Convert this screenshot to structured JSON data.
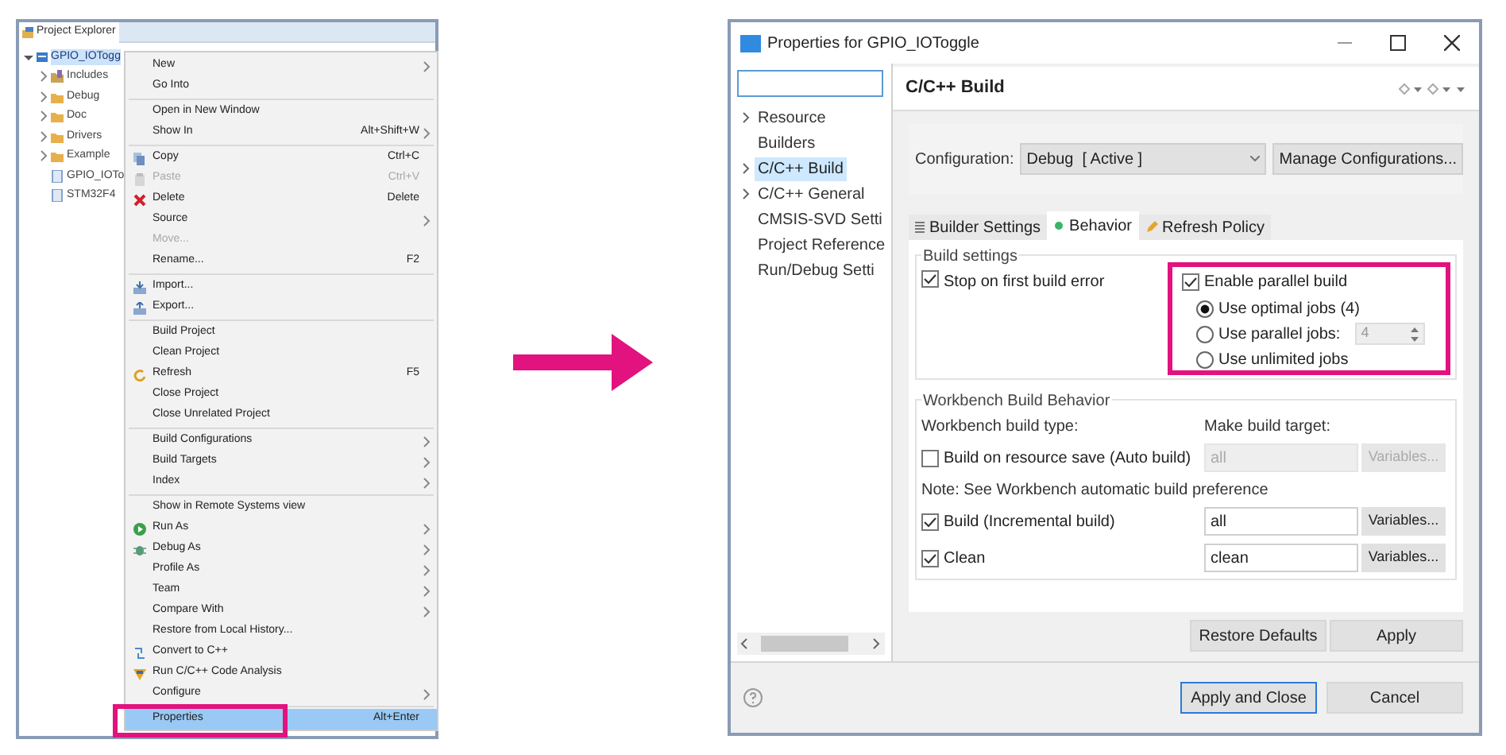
{
  "explorer": {
    "tab_title": "Project Explorer",
    "project": {
      "label": "GPIO_IOTogg",
      "expanded": true,
      "selected": true
    },
    "children": [
      {
        "label": "Includes",
        "kind": "includes",
        "expanded": false
      },
      {
        "label": "Debug",
        "kind": "folder",
        "expanded": false
      },
      {
        "label": "Doc",
        "kind": "folder",
        "expanded": false
      },
      {
        "label": "Drivers",
        "kind": "folder",
        "expanded": false
      },
      {
        "label": "Example",
        "kind": "folder",
        "expanded": false
      },
      {
        "label": "GPIO_IOTo",
        "kind": "file"
      },
      {
        "label": "STM32F4",
        "kind": "file"
      }
    ]
  },
  "context_menu": {
    "groups": [
      [
        {
          "label": "New",
          "submenu": true,
          "disabled": false,
          "selected": false
        },
        {
          "label": "Go Into",
          "disabled": false,
          "selected": false
        }
      ],
      [
        {
          "label": "Open in New Window",
          "disabled": false,
          "selected": false
        },
        {
          "label": "Show In",
          "shortcut": "Alt+Shift+W",
          "submenu": true,
          "disabled": false,
          "selected": false
        }
      ],
      [
        {
          "label": "Copy",
          "shortcut": "Ctrl+C",
          "kind": "copy",
          "disabled": false,
          "selected": false
        },
        {
          "label": "Paste",
          "shortcut": "Ctrl+V",
          "kind": "paste",
          "disabled": true,
          "selected": false
        },
        {
          "label": "Delete",
          "shortcut": "Delete",
          "kind": "delete",
          "disabled": false,
          "selected": false
        },
        {
          "label": "Source",
          "submenu": true,
          "disabled": false,
          "selected": false
        },
        {
          "label": "Move...",
          "disabled": true,
          "selected": false
        },
        {
          "label": "Rename...",
          "shortcut": "F2",
          "disabled": false,
          "selected": false
        }
      ],
      [
        {
          "label": "Import...",
          "kind": "import",
          "disabled": false,
          "selected": false
        },
        {
          "label": "Export...",
          "kind": "export",
          "disabled": false,
          "selected": false
        }
      ],
      [
        {
          "label": "Build Project",
          "disabled": false,
          "selected": false
        },
        {
          "label": "Clean Project",
          "disabled": false,
          "selected": false
        },
        {
          "label": "Refresh",
          "shortcut": "F5",
          "kind": "refresh",
          "disabled": false,
          "selected": false
        },
        {
          "label": "Close Project",
          "disabled": false,
          "selected": false
        },
        {
          "label": "Close Unrelated Project",
          "disabled": false,
          "selected": false
        }
      ],
      [
        {
          "label": "Build Configurations",
          "submenu": true,
          "disabled": false,
          "selected": false
        },
        {
          "label": "Build Targets",
          "submenu": true,
          "disabled": false,
          "selected": false
        },
        {
          "label": "Index",
          "submenu": true,
          "disabled": false,
          "selected": false
        }
      ],
      [
        {
          "label": "Show in Remote Systems view",
          "disabled": false,
          "selected": false
        },
        {
          "label": "Run As",
          "submenu": true,
          "kind": "run",
          "disabled": false,
          "selected": false
        },
        {
          "label": "Debug As",
          "submenu": true,
          "kind": "debug",
          "disabled": false,
          "selected": false
        },
        {
          "label": "Profile As",
          "submenu": true,
          "disabled": false,
          "selected": false
        },
        {
          "label": "Team",
          "submenu": true,
          "disabled": false,
          "selected": false
        },
        {
          "label": "Compare With",
          "submenu": true,
          "disabled": false,
          "selected": false
        },
        {
          "label": "Restore from Local History...",
          "disabled": false,
          "selected": false
        },
        {
          "label": "Convert to C++",
          "kind": "convert",
          "disabled": false,
          "selected": false
        },
        {
          "label": "Run C/C++ Code Analysis",
          "kind": "analysis",
          "disabled": false,
          "selected": false
        },
        {
          "label": "Configure",
          "submenu": true,
          "disabled": false,
          "selected": false
        }
      ],
      [
        {
          "label": "Properties",
          "shortcut": "Alt+Enter",
          "disabled": false,
          "selected": true,
          "annotated": true
        }
      ]
    ]
  },
  "dialog": {
    "title": "Properties for GPIO_IOToggle",
    "nav": [
      {
        "label": "Resource",
        "expanded": false,
        "selected": false
      },
      {
        "label": "Builders",
        "selected": false
      },
      {
        "label": "C/C++ Build",
        "expanded": false,
        "selected": true
      },
      {
        "label": "C/C++ General",
        "expanded": false,
        "selected": false
      },
      {
        "label": "CMSIS-SVD Setti",
        "selected": false
      },
      {
        "label": "Project Reference",
        "selected": false
      },
      {
        "label": "Run/Debug Setti",
        "selected": false
      }
    ],
    "page_title": "C/C++ Build",
    "configuration": {
      "label": "Configuration:",
      "value": "Debug  [ Active ]",
      "button": "Manage Configurations..."
    },
    "tabs": [
      {
        "label": "Builder Settings",
        "kind": "list",
        "selected": false
      },
      {
        "label": "Behavior",
        "kind": "dot",
        "selected": true
      },
      {
        "label": "Refresh Policy",
        "kind": "pencil",
        "selected": false
      }
    ],
    "build_settings": {
      "title": "Build settings",
      "stop_on_error": {
        "label": "Stop on first build error",
        "checked": true
      },
      "parallel": {
        "annotated": true,
        "label": "Enable parallel build",
        "checked": true,
        "options": [
          {
            "label": "Use optimal jobs (4)",
            "selected": true
          },
          {
            "label": "Use parallel jobs:",
            "selected": false,
            "spinner": "4"
          },
          {
            "label": "Use unlimited jobs",
            "selected": false
          }
        ]
      }
    },
    "workbench": {
      "title": "Workbench Build Behavior",
      "type_label": "Workbench build type:",
      "target_label": "Make build target:",
      "auto": {
        "label": "Build on resource save (Auto build)",
        "checked": false,
        "value": "all",
        "button": "Variables...",
        "disabled": true
      },
      "note": "Note: See Workbench automatic build preference",
      "rows": [
        {
          "label": "Build (Incremental build)",
          "checked": true,
          "value": "all",
          "button": "Variables..."
        },
        {
          "label": "Clean",
          "checked": true,
          "value": "clean",
          "button": "Variables..."
        }
      ]
    },
    "page_buttons": [
      "Restore Defaults",
      "Apply"
    ],
    "footer_buttons": [
      {
        "label": "Apply and Close",
        "default": true
      },
      {
        "label": "Cancel",
        "default": false
      }
    ]
  }
}
